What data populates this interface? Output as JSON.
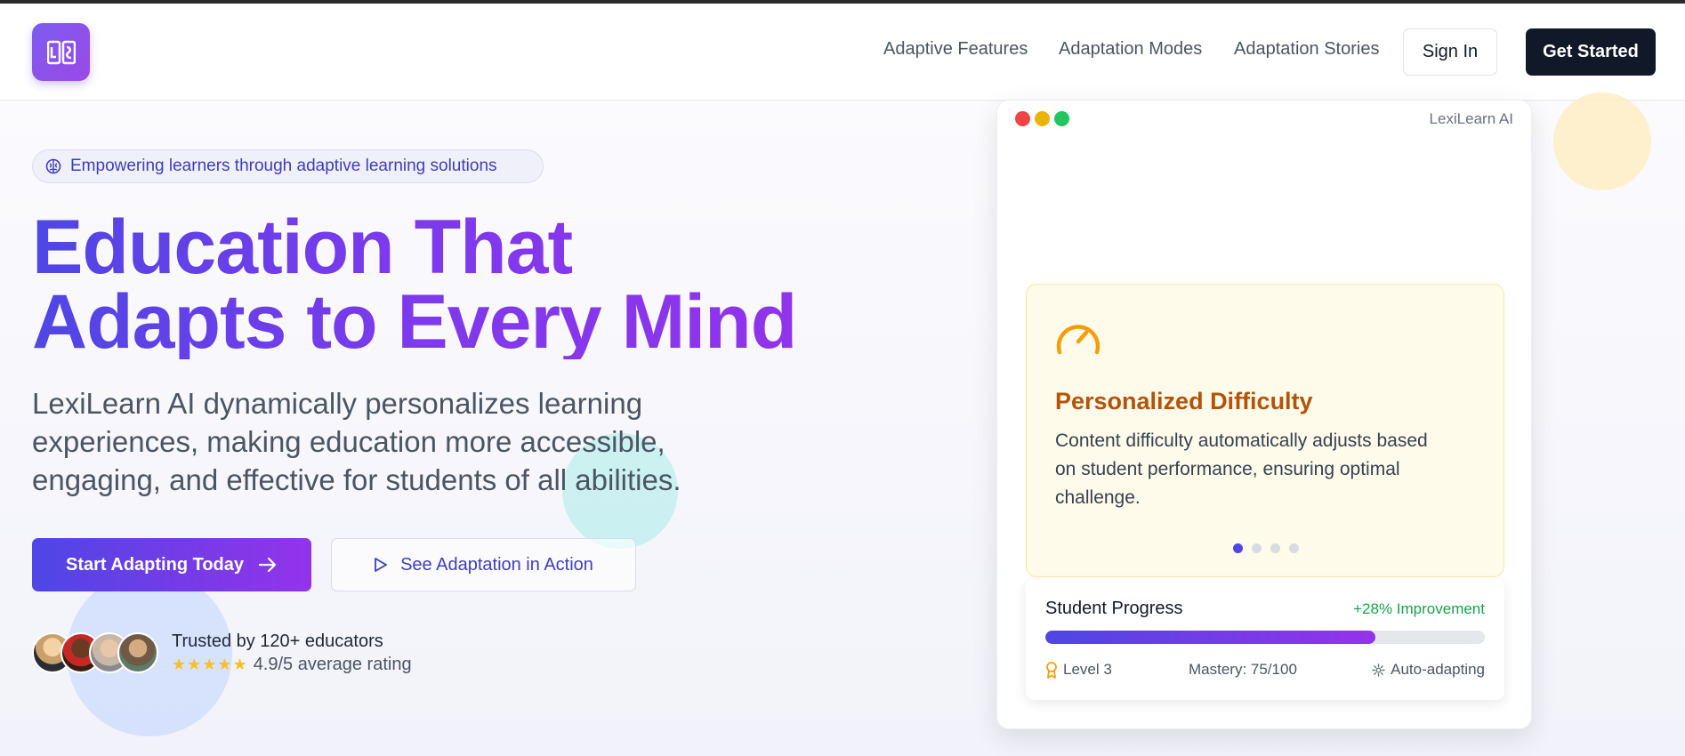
{
  "nav": {
    "logo_icon": "book-open-icon",
    "links": [
      "Adaptive Features",
      "Adaptation Modes",
      "Adaptation Stories"
    ],
    "sign_in": "Sign In",
    "get_started": "Get Started"
  },
  "hero": {
    "badge_icon": "brain-icon",
    "badge": "Empowering learners through adaptive learning solutions",
    "headline": [
      "Education That",
      "Adapts to Every Mind"
    ],
    "subtext": [
      "LexiLearn AI dynamically personalizes learning",
      "experiences, making education more accessible,",
      "engaging, and effective for students of all abilities."
    ],
    "primary_cta": "Start Adapting Today",
    "secondary_cta": "See Adaptation in Action",
    "trusted": "Trusted by 120+ educators",
    "stars": "★★★★★",
    "rating": "4.9/5 average rating"
  },
  "mockup": {
    "app_title": "LexiLearn AI",
    "feature": {
      "icon": "gauge-icon",
      "title": "Personalized Difficulty",
      "description": [
        "Content difficulty automatically adjusts based",
        "on student performance, ensuring optimal",
        "challenge."
      ],
      "slides": 4,
      "active_slide": 1
    },
    "progress": {
      "title": "Student Progress",
      "improvement": "+28% Improvement",
      "fill_percent": 75,
      "level": "Level 3",
      "mastery": "Mastery: 75/100",
      "mode": "Auto-adapting"
    }
  },
  "colors": {
    "brand_indigo": "#4f46e5",
    "brand_purple": "#9333ea",
    "feature_amber": "#b45309",
    "success_green": "#16a34a",
    "dark_button": "#111827"
  }
}
